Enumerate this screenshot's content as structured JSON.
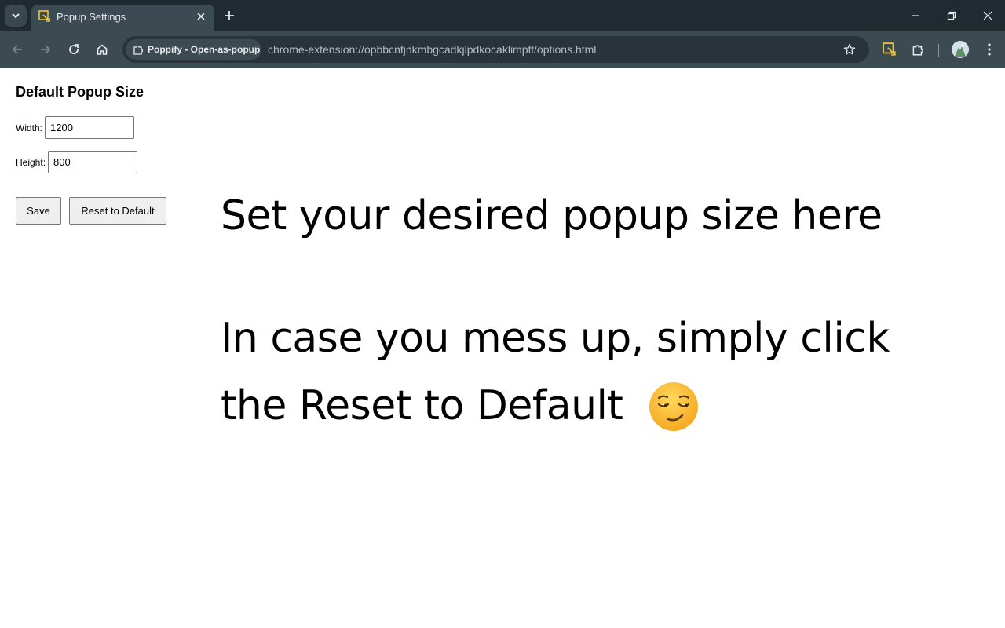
{
  "browser": {
    "tab": {
      "title": "Popup Settings"
    },
    "omnibox": {
      "chip_label": "Poppify - Open-as-popup",
      "url": "chrome-extension://opbbcnfjnkmbgcadkjlpdkocaklimpff/options.html"
    }
  },
  "page": {
    "heading": "Default Popup Size",
    "width_label": "Width:",
    "width_value": "1200",
    "height_label": "Height:",
    "height_value": "800",
    "save_label": "Save",
    "reset_label": "Reset to Default",
    "message_line1": "Set your desired popup size here",
    "message_line2": "In case you mess up, simply click",
    "message_line3": "the Reset to Default"
  },
  "icons": {
    "tab_list": "chevron-down-icon",
    "favicon": "extension-favicon",
    "close": "close-icon",
    "new_tab": "plus-icon",
    "back": "arrow-left-icon",
    "forward": "arrow-right-icon",
    "reload": "reload-icon",
    "home": "home-icon",
    "bookmark": "star-icon",
    "extension": "puzzle-icon",
    "emoji": "relieved-face-emoji"
  },
  "colors": {
    "tabstrip": "#202b31",
    "toolbar": "#3c4a51",
    "omnibox": "#28343a"
  }
}
